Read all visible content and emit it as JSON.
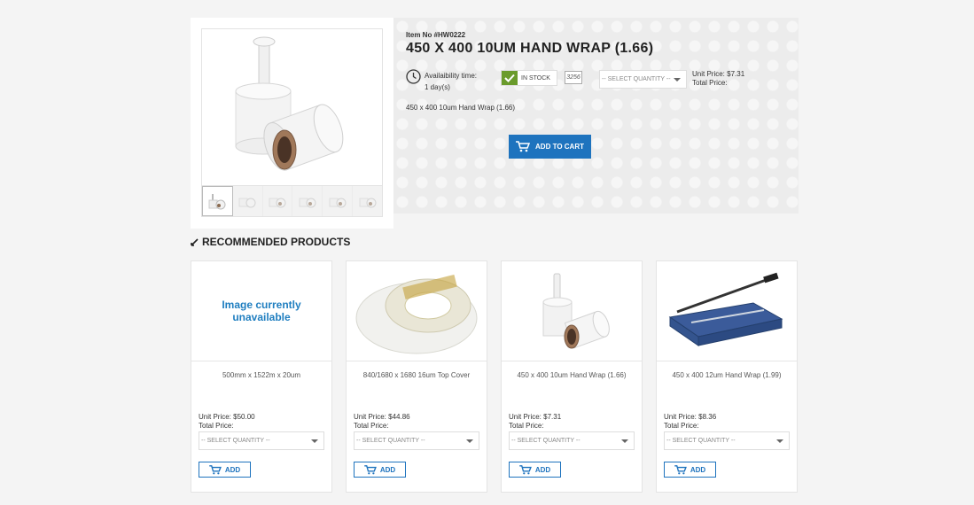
{
  "product": {
    "item_no": "Item No #HW0222",
    "title": "450 X 400 10UM HAND WRAP (1.66)",
    "availability_label": "Availaibility time:",
    "availability_value": "1 day(s)",
    "stock_status": "IN STOCK",
    "stock_qty": "3256",
    "select_placeholder": "-- SELECT QUANTITY --",
    "unit_price": "Unit Price: $7.31",
    "total_price": "Total Price:",
    "description": "450 x 400 10um Hand Wrap (1.66)",
    "add_to_cart": "ADD TO CART",
    "thumbnail_count": 6
  },
  "recommended": {
    "heading": "RECOMMENDED PRODUCTS",
    "items": [
      {
        "name": "500mm x 1522m x 20um",
        "unit_price": "Unit Price: $50.00",
        "total_price": "Total Price:",
        "select": "-- SELECT QUANTITY --",
        "add": "ADD",
        "image_text_1": "Image currently",
        "image_text_2": "unavailable"
      },
      {
        "name": "840/1680 x 1680 16um Top Cover",
        "unit_price": "Unit Price: $44.86",
        "total_price": "Total Price:",
        "select": "-- SELECT QUANTITY --",
        "add": "ADD"
      },
      {
        "name": "450 x 400 10um Hand Wrap (1.66)",
        "unit_price": "Unit Price: $7.31",
        "total_price": "Total Price:",
        "select": "-- SELECT QUANTITY --",
        "add": "ADD"
      },
      {
        "name": "450 x 400 12um Hand Wrap (1.99)",
        "unit_price": "Unit Price: $8.36",
        "total_price": "Total Price:",
        "select": "-- SELECT QUANTITY --",
        "add": "ADD"
      }
    ]
  },
  "colors": {
    "accent": "#1e73be",
    "stock_green": "#6a9b2c",
    "info_bg": "#ececec"
  },
  "icons": {
    "clock": "clock-icon",
    "check": "check-icon",
    "cart": "cart-icon",
    "caret": "chevron-down-icon",
    "heading": "pencil-icon"
  }
}
